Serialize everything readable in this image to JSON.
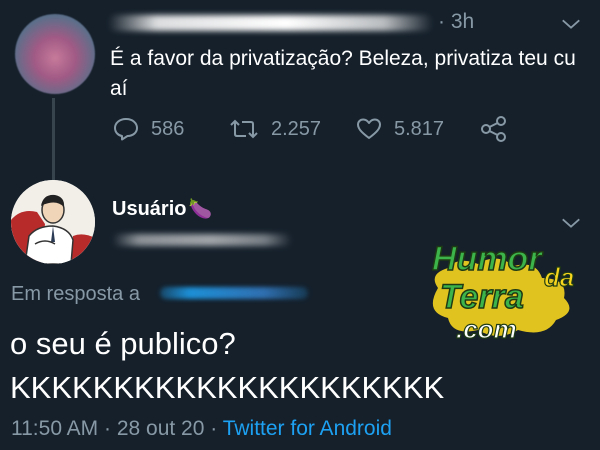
{
  "first_tweet": {
    "time": "· 3h",
    "text": "É a favor da privatização? Beleza, privatiza teu cu aí",
    "stats": {
      "replies": "586",
      "retweets": "2.257",
      "likes": "5.817"
    }
  },
  "reply_tweet": {
    "display_name": "Usuário",
    "name_emoji": "🍆",
    "reply_label": "Em resposta a",
    "text_line1": "o seu é publico?",
    "text_line2": "KKKKKKKKKKKKKKKKKKKKK",
    "timestamp": "11:50 AM · 28 out 20 · ",
    "source": "Twitter for Android"
  },
  "watermark": {
    "line1": "Humor",
    "line2": "da",
    "line3": "Terra",
    "line4": ".com"
  },
  "colors": {
    "background": "#15202b",
    "secondary_text": "#8899a6",
    "link": "#1da1f2",
    "thread_line": "#38444d",
    "watermark_fill": "#3cb44a",
    "watermark_accent": "#f7d51e"
  }
}
